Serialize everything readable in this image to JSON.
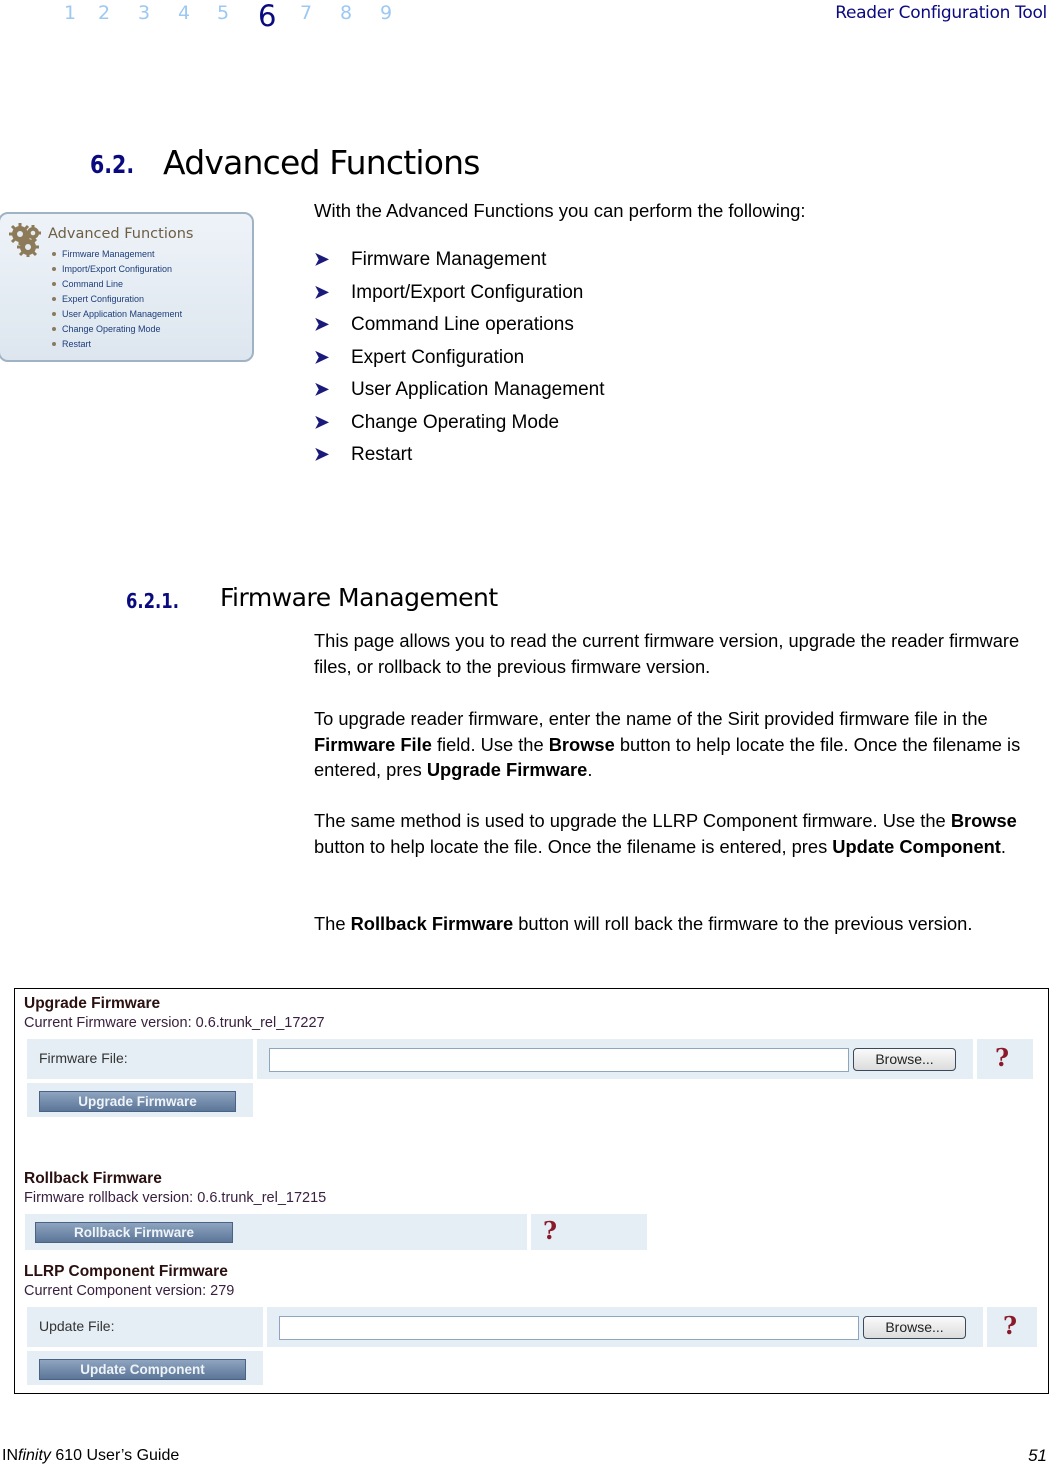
{
  "header": {
    "chapters": [
      "1",
      "2",
      "3",
      "4",
      "5",
      "6",
      "7",
      "8",
      "9"
    ],
    "active_chapter": "6",
    "title": "Reader Configuration Tool"
  },
  "section": {
    "number": "6.2.",
    "title": "Advanced Functions",
    "intro": "With the Advanced Functions you can perform the following:",
    "bullets": [
      "Firmware Management",
      "Import/Export Configuration",
      "Command Line operations",
      "Expert Configuration",
      "User Application Management",
      "Change Operating Mode",
      "Restart"
    ]
  },
  "thumbnail": {
    "title": "Advanced Functions",
    "items": [
      "Firmware Management",
      "Import/Export Configuration",
      "Command Line",
      "Expert Configuration",
      "User Application Management",
      "Change Operating Mode",
      "Restart"
    ]
  },
  "subsection": {
    "number": "6.2.1.",
    "title": "Firmware Management",
    "para1": "This page allows you to read the current firmware version, upgrade the reader firmware files, or rollback to the previous firmware version.",
    "para2": {
      "t1": "To upgrade reader firmware, enter the name of the Sirit provided firmware file in the ",
      "b1": "Firmware File",
      "t2": " field. Use the ",
      "b2": "Browse",
      "t3": " button to help locate the file. Once the filename is entered, pres ",
      "b3": "Upgrade Firmware",
      "t4": "."
    },
    "para3": {
      "t1": "The same method is used to upgrade the LLRP Component firmware. Use the ",
      "b1": "Browse",
      "t2": " button to help locate the file. Once the filename is entered, pres ",
      "b2": "Update Component",
      "t3": "."
    },
    "para4": {
      "t1": "The ",
      "b1": "Rollback Firmware",
      "t2": " button will roll back the firmware to the previous version."
    }
  },
  "screenshot": {
    "upgrade": {
      "heading": "Upgrade Firmware",
      "version_text": "Current Firmware version: 0.6.trunk_rel_17227",
      "file_label": "Firmware File:",
      "file_value": "",
      "browse_label": "Browse...",
      "button_label": "Upgrade Firmware",
      "help": "?"
    },
    "rollback": {
      "heading": "Rollback Firmware",
      "version_text": "Firmware rollback version: 0.6.trunk_rel_17215",
      "button_label": "Rollback Firmware",
      "help": "?"
    },
    "llrp": {
      "heading": "LLRP Component Firmware",
      "version_text": "Current Component version: 279",
      "file_label": "Update File:",
      "file_value": "",
      "browse_label": "Browse...",
      "button_label": "Update Component",
      "help": "?"
    }
  },
  "footer": {
    "product_prefix": "IN",
    "product_italic": "finity",
    "product_rest": " 610 User’s Guide",
    "page_number": "51"
  }
}
